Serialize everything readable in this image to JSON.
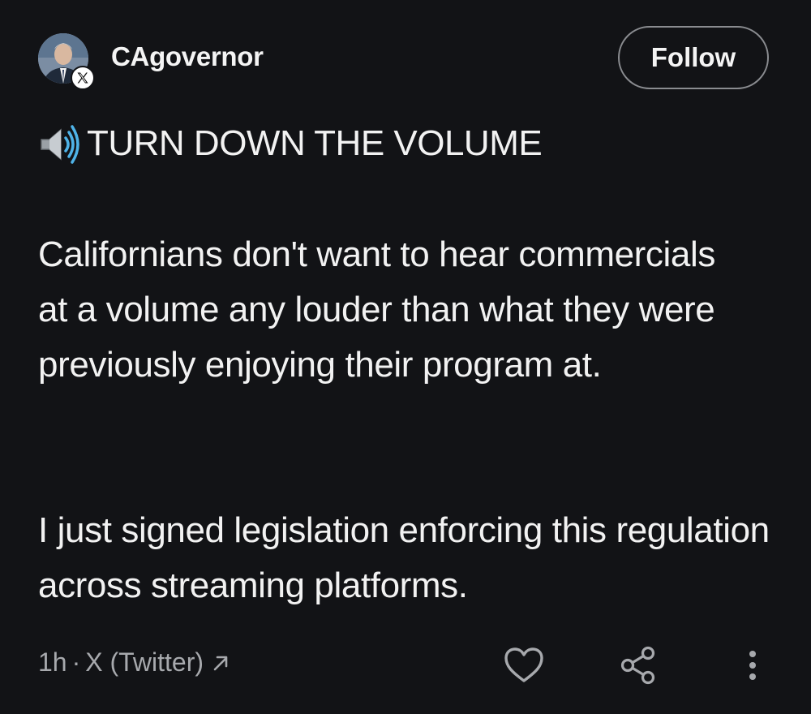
{
  "post": {
    "username": "CAgovernor",
    "follow_label": "Follow",
    "headline": "TURN DOWN THE VOLUME",
    "paragraphs": [
      "Californians don't want to hear commercials at a volume any louder than what they were previously enjoying their program at.",
      "I just signed legislation enforcing this regulation across streaming platforms."
    ],
    "time": "1h",
    "separator": "·",
    "source": "X (Twitter)"
  },
  "icons": {
    "avatar_badge": "x-logo-icon",
    "headline_emoji": "speaker-high-volume-icon",
    "source_link": "arrow-up-right-icon",
    "like": "heart-icon",
    "share": "share-icon",
    "more": "more-vertical-icon"
  },
  "colors": {
    "background": "#121316",
    "text": "#f2f2f2",
    "meta_text": "#a7a9ad",
    "button_border": "#8a8c90"
  }
}
